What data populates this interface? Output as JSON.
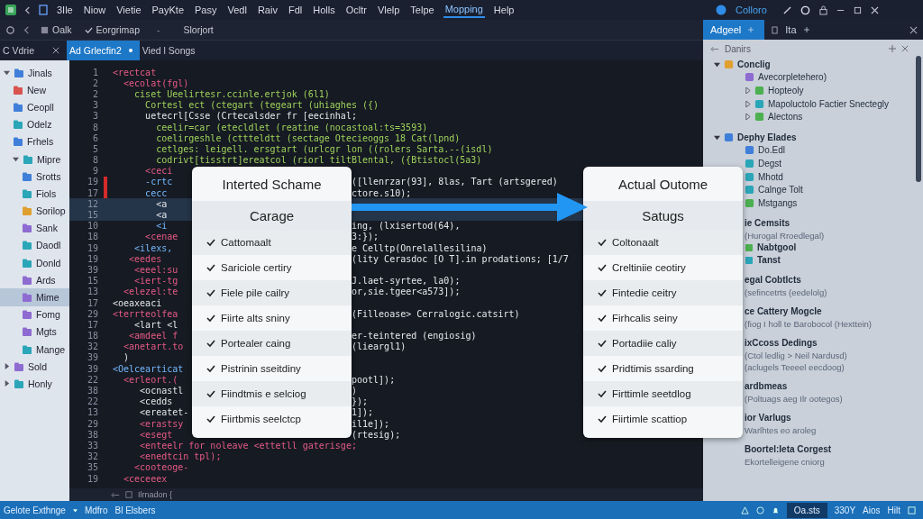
{
  "menu": {
    "items": [
      {
        "label": "3Ile",
        "selected": false
      },
      {
        "label": "Niow",
        "selected": false
      },
      {
        "label": "Vietie",
        "selected": false
      },
      {
        "label": "PayKte",
        "selected": false
      },
      {
        "label": "Pasy",
        "selected": false
      },
      {
        "label": "Vedl",
        "selected": false
      },
      {
        "label": "Raiv",
        "selected": false
      },
      {
        "label": "Fdl",
        "selected": false
      },
      {
        "label": "Holls",
        "selected": false
      },
      {
        "label": "Ocltr",
        "selected": false
      },
      {
        "label": "Vlelp",
        "selected": false
      },
      {
        "label": "Telpe",
        "selected": false
      },
      {
        "label": "Mopping",
        "selected": true
      },
      {
        "label": "Help",
        "selected": false
      }
    ],
    "account": "Colloro"
  },
  "toolbar": {
    "buttons": [
      "Oalk",
      "Eorgrimap"
    ],
    "separator": "-",
    "label": "Slorjort"
  },
  "editor_tabs": [
    {
      "label": "C Vdrie",
      "selected": false
    },
    {
      "label": "Ad Grlecfin2",
      "selected": true
    },
    {
      "label": "Vied l Songs",
      "selected": false
    }
  ],
  "sidebar": {
    "tree": [
      {
        "label": "Jinals",
        "expanded": true,
        "children": [
          {
            "label": "New"
          },
          {
            "label": "Ceopll"
          },
          {
            "label": "Odelz"
          },
          {
            "label": "Frhels"
          },
          {
            "label": "Mipre",
            "expanded": true,
            "children": [
              {
                "label": "Srotts",
                "selected": false
              },
              {
                "label": "Fiols",
                "selected": false
              },
              {
                "label": "Sorilop",
                "selected": false
              },
              {
                "label": "Sank",
                "selected": false
              },
              {
                "label": "Daodl",
                "selected": false
              },
              {
                "label": "Donld",
                "selected": false
              },
              {
                "label": "Ards",
                "selected": false
              },
              {
                "label": "Mime",
                "selected": true
              },
              {
                "label": "Fomg",
                "selected": false
              },
              {
                "label": "Mgts",
                "selected": false
              },
              {
                "label": "Mange",
                "selected": false
              }
            ]
          }
        ]
      },
      {
        "label": "Sold",
        "expanded": false
      },
      {
        "label": "Honly",
        "expanded": false
      }
    ]
  },
  "editor": {
    "lines": [
      {
        "n": "1",
        "kind": "tag",
        "a": "<rectcat",
        "current": false,
        "error": false
      },
      {
        "n": "2",
        "kind": "tag",
        "a": "  <ecolat(fgl)",
        "current": false,
        "error": false
      },
      {
        "n": "2",
        "kind": "code",
        "a": "    ciset Ueelirtesr.ccinle.ertjok (6l1)",
        "current": false,
        "error": false
      },
      {
        "n": "3",
        "kind": "code",
        "a": "      Cortesl ect (ctegart (tegeart (uhiaghes ({)",
        "current": false,
        "error": false
      },
      {
        "n": "3",
        "kind": "plain",
        "a": "      uetecrl[Csse (Crtecalsder fr [eecinhal;",
        "current": false,
        "error": false
      },
      {
        "n": "8",
        "kind": "code",
        "a": "        ceelir=car (etecldlet (reatine (nocastoal:ts=3593)",
        "current": false,
        "error": false
      },
      {
        "n": "6",
        "kind": "code",
        "a": "        coelirgeshle (cttteldtt (sectage Otecieoggs 18 Cat(lpnd)",
        "current": false,
        "error": false
      },
      {
        "n": "5",
        "kind": "code",
        "a": "        cetlges: leigell. ersgtart (urlcgr lon ((rolers Sarta.--(isdl)",
        "current": false,
        "error": false
      },
      {
        "n": "8",
        "kind": "code",
        "a": "        codrivt[tisstrt]ereatcol (riorl tiltBlental, ({Btistocl(5a3)",
        "current": false,
        "error": false
      },
      {
        "n": "9",
        "kind": "tag",
        "a": "      <ceci",
        "current": false,
        "error": false
      },
      {
        "n": "19",
        "kind": "attr",
        "a": "      -crtc",
        "b": "([llenrzar(93], 8las, Tart (artsgered)",
        "current": false,
        "error": true
      },
      {
        "n": "17",
        "kind": "attr",
        "a": "      cecc",
        "b": "ctore.s10);",
        "current": false,
        "error": true
      },
      {
        "n": "12",
        "kind": "plain",
        "a": "        <a",
        "current": true,
        "error": false
      },
      {
        "n": "15",
        "kind": "plain",
        "a": "        <a",
        "current": true,
        "error": false
      },
      {
        "n": "10",
        "kind": "attr",
        "a": "        <i",
        "b": "ing, (lxisertod(64),",
        "current": false,
        "error": false
      },
      {
        "n": "18",
        "kind": "tag",
        "a": "      <cenae",
        "b": "3:});",
        "current": false,
        "error": false
      },
      {
        "n": "19",
        "kind": "attr",
        "a": "    <ilexs,",
        "b": "e Celltp(Onrelallesilina)",
        "current": false,
        "error": false
      },
      {
        "n": "19",
        "kind": "tag",
        "a": "   <eedes",
        "b": "(lity Cerasdoc [O T].in prodations; [1/7",
        "current": false,
        "error": false
      },
      {
        "n": "39",
        "kind": "tag",
        "a": "    <eeel:su",
        "current": false,
        "error": false
      },
      {
        "n": "15",
        "kind": "tag",
        "a": "    <iert-tg",
        "b": "J.laet-syrtee, la0);",
        "current": false,
        "error": false
      },
      {
        "n": "13",
        "kind": "tag",
        "a": "  <elezel:te",
        "b": "or,sie.tgeer<a573]);",
        "current": false,
        "error": false
      },
      {
        "n": "17",
        "kind": "plain",
        "a": "<oeaxeaci",
        "current": false,
        "error": false
      },
      {
        "n": "29",
        "kind": "tag",
        "a": "<terrteolfea",
        "b": "(Filleoase> Cerralogic.catsirt)",
        "current": false,
        "error": false
      },
      {
        "n": "17",
        "kind": "plain",
        "a": "    <lart <l",
        "current": false,
        "error": false
      },
      {
        "n": "18",
        "kind": "tag",
        "a": "   <amdeel f",
        "b": "er-teintered (engiosig)",
        "current": false,
        "error": false
      },
      {
        "n": "32",
        "kind": "tag",
        "a": "  <anetart.to",
        "b": "(lieargl1)",
        "current": false,
        "error": false
      },
      {
        "n": "39",
        "kind": "plain",
        "a": "  )",
        "current": false,
        "error": false
      },
      {
        "n": "39",
        "kind": "attr",
        "a": "<Oelcearticat",
        "current": false,
        "error": false
      },
      {
        "n": "22",
        "kind": "tag",
        "a": "  <erleort.(",
        "b": "pootl]);",
        "current": false,
        "error": false
      },
      {
        "n": "38",
        "kind": "plain",
        "a": "     <ocnastl",
        "b": ")",
        "current": false,
        "error": false
      },
      {
        "n": "22",
        "kind": "plain",
        "a": "     <cedds",
        "b": "});",
        "current": false,
        "error": false
      },
      {
        "n": "13",
        "kind": "plain",
        "a": "     <ereatet-",
        "b": "1]);",
        "current": false,
        "error": false
      },
      {
        "n": "29",
        "kind": "tag",
        "a": "     <erastsy",
        "b": "il1e]);",
        "current": false,
        "error": false
      },
      {
        "n": "38",
        "kind": "tag",
        "a": "     <esegt",
        "b": "(rtesig);",
        "current": false,
        "error": false
      },
      {
        "n": "33",
        "kind": "tag",
        "a": "     <enteelr for noleave <ettetll gaterisge;",
        "current": false,
        "error": false
      },
      {
        "n": "32",
        "kind": "tag",
        "a": "     <enedtcin tpl);",
        "current": false,
        "error": false
      },
      {
        "n": "35",
        "kind": "tag",
        "a": "    <cooteoge-",
        "current": false,
        "error": false
      },
      {
        "n": "19",
        "kind": "tag",
        "a": "  <ceceeex",
        "current": false,
        "error": false
      }
    ],
    "footer": "Ilrnadon {"
  },
  "comparison": [
    {
      "title": "Interted Schame",
      "subtitle": "Carage",
      "items": [
        {
          "label": "Cattomaalt",
          "checked": true
        },
        {
          "label": "Sariciole certiry",
          "checked": true
        },
        {
          "label": "Fiele pile cailry",
          "checked": true
        },
        {
          "label": "Fiirte alts sniny",
          "checked": true
        },
        {
          "label": "Portealer caing",
          "checked": true
        },
        {
          "label": "Pistrinin sseitdiny",
          "checked": true
        },
        {
          "label": "Fiindtmis e selciog",
          "checked": true
        },
        {
          "label": "Fiirtbmis seelctcp",
          "checked": true
        }
      ]
    },
    {
      "title": "Actual Outome",
      "subtitle": "Satugs",
      "items": [
        {
          "label": "Coltonaalt",
          "checked": true
        },
        {
          "label": "Creltiniie ceotiry",
          "checked": true
        },
        {
          "label": "Fintedie ceitry",
          "checked": true
        },
        {
          "label": "Firhcalis seiny",
          "checked": true
        },
        {
          "label": "Portadiie caliy",
          "checked": true
        },
        {
          "label": "Pridtimis ssarding",
          "checked": true
        },
        {
          "label": "Firttimle seetdlog",
          "checked": true
        },
        {
          "label": "Fiirtimle scattiop",
          "checked": true
        }
      ]
    }
  ],
  "panel": {
    "tabs": [
      {
        "label": "Adgeel",
        "selected": true
      },
      {
        "label": "Ita",
        "selected": false
      }
    ],
    "title": "Danirs",
    "tree": [
      {
        "label": "Conclig",
        "expanded": true,
        "children": [
          {
            "label": "Avecorpletehero)"
          },
          {
            "label": "Hopteoly",
            "expanded": false
          },
          {
            "label": "Mapoluctolo Factier Snectegly",
            "expanded": false
          },
          {
            "label": "Alectons",
            "expanded": false
          }
        ]
      },
      {
        "label": "Dephy Elades",
        "expanded": true,
        "children": [
          {
            "label": "Do.Edl"
          },
          {
            "label": "Degst"
          },
          {
            "label": "Mhotd"
          },
          {
            "label": "Calnge Tolt"
          },
          {
            "label": "Mstgangs"
          }
        ]
      }
    ],
    "sections": [
      {
        "title": "ie Cemsits",
        "notes": [
          "(Hurogal Rroedlegal)"
        ],
        "items": [
          "Nabtgool",
          "Tanst"
        ]
      },
      {
        "title": "egal Cobtlcts",
        "notes": [
          "(sefincetrts (eedelolg)"
        ]
      },
      {
        "title": "ce Cattery Mogcle",
        "notes": [
          "(fiog I holl te Barobocol (Hexttein)"
        ]
      },
      {
        "title": "ixCcoss Dedings",
        "notes": [
          "(Ctol ledlig > Neil Nardusd)",
          "(aclugels Teeeel eecdoog)"
        ]
      },
      {
        "title": "ardbmeas",
        "notes": [
          "(Poltuags aeg Ilr ootegos)"
        ]
      },
      {
        "title": "ior Varlugs",
        "notes": [
          "Warlhtes eo aroleg"
        ]
      },
      {
        "title": "Boortel:Ieta Corgest",
        "notes": [
          "Ekortelleigene cniorg"
        ]
      }
    ]
  },
  "status_bar": {
    "left": [
      "Gelote Exthnge",
      "Mdfro",
      "Bl Elsbers"
    ],
    "right": [
      {
        "label": "Oa.sts",
        "selected": true
      },
      {
        "label": "330Y",
        "selected": false
      },
      {
        "label": "Aios",
        "selected": false
      },
      {
        "label": "Hilt",
        "selected": false
      }
    ]
  }
}
